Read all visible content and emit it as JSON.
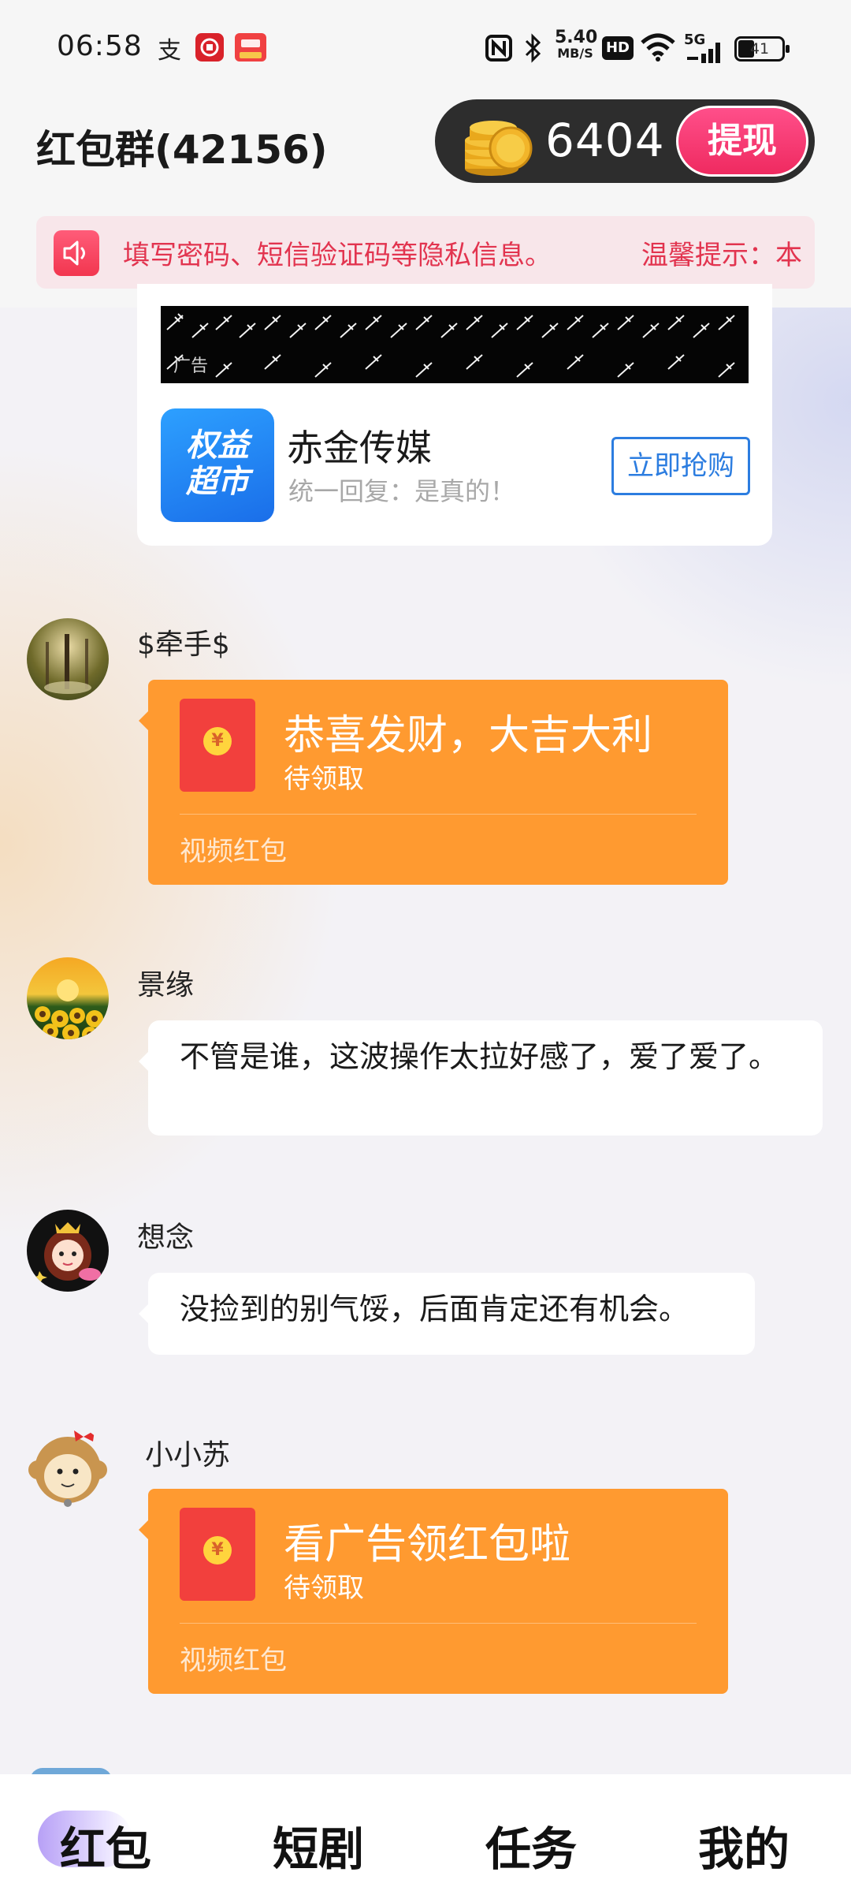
{
  "status_bar": {
    "time": "06:58",
    "network_speed_value": "5.40",
    "network_speed_unit": "MB/S",
    "hd": "HD",
    "signal_label": "5G",
    "battery": "41"
  },
  "header": {
    "title": "红包群(42156)",
    "coin_count": "6404",
    "withdraw_label": "提现"
  },
  "notice": {
    "text": "填写密码、短信验证码等隐私信息。",
    "text2": "温馨提示：本"
  },
  "ad": {
    "badge": "广告",
    "logo_text_line1": "权益",
    "logo_text_line2": "超市",
    "title": "赤金传媒",
    "subtitle": "统一回复：是真的！",
    "button_label": "立即抢购"
  },
  "messages": [
    {
      "sender": "$牵手$",
      "type": "red_packet",
      "title": "恭喜发财，大吉大利",
      "status": "待领取",
      "packet_type": "视频红包"
    },
    {
      "sender": "景缘",
      "type": "text",
      "text": "不管是谁，这波操作太拉好感了，爱了爱了。"
    },
    {
      "sender": "想念",
      "type": "text",
      "text": "没捡到的别气馁，后面肯定还有机会。"
    },
    {
      "sender": "小小苏",
      "type": "red_packet",
      "title": "看广告领红包啦",
      "status": "待领取",
      "packet_type": "视频红包"
    }
  ],
  "bottom_nav": {
    "items": [
      "红包",
      "短剧",
      "任务",
      "我的"
    ],
    "active_index": 0
  },
  "colors": {
    "red_packet": "#ff9a30",
    "withdraw": "#ef2a60",
    "notice_text": "#e2344f",
    "ad_button": "#2c7de0"
  }
}
